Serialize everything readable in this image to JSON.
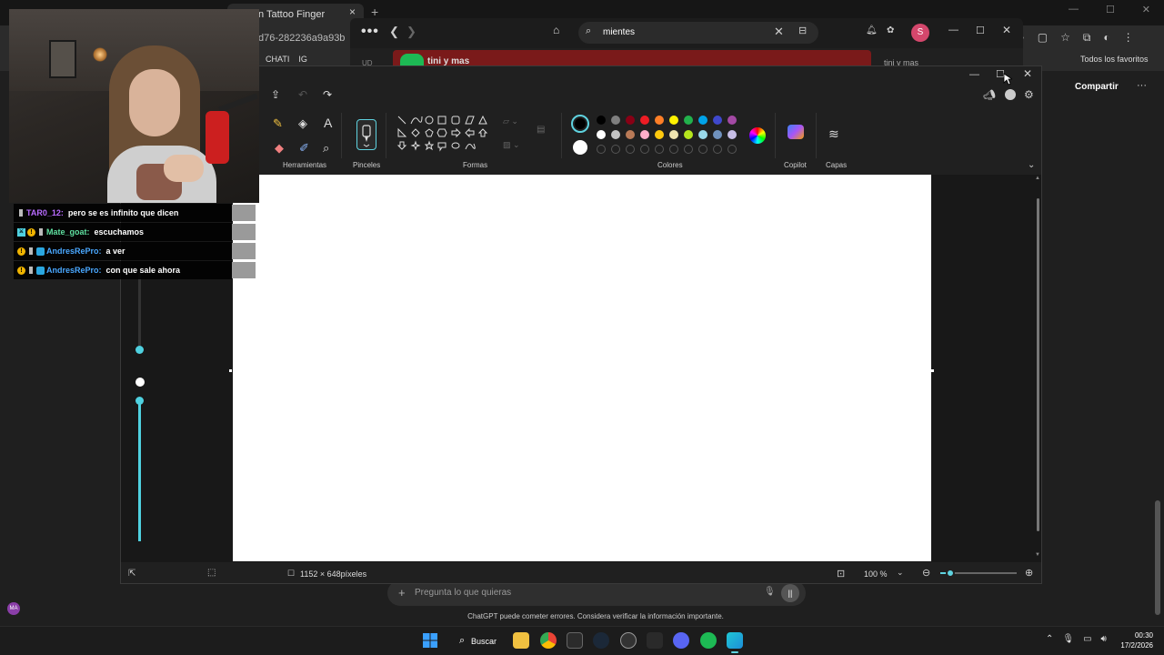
{
  "browser": {
    "tab_title": "n Tattoo Finger",
    "tab_close": "×",
    "new_tab": "+",
    "url_fragment": "d76-282236a9a93b",
    "bookmarks": [
      "CHATI",
      "IG"
    ],
    "favorites_label": "Todos los favoritos",
    "share_label": "Compartir",
    "more": "···",
    "window_controls": [
      "—",
      "☐",
      "✕"
    ]
  },
  "edge": {
    "menu": "•••",
    "search_text": "mientes",
    "profile_initial": "S",
    "banner_text": "tini y mas",
    "banner_text_right": "tini y mas",
    "tab_label": "UD"
  },
  "paint": {
    "groups": {
      "tools": "Herramientas",
      "brushes": "Pinceles",
      "shapes": "Formas",
      "colors": "Colores",
      "copilot": "Copilot",
      "layers": "Capas"
    },
    "primary_color": "#000000",
    "secondary_color": "#ffffff",
    "palette_row1": [
      "#000000",
      "#7f7f7f",
      "#880015",
      "#ed1c24",
      "#ff7f27",
      "#fff200",
      "#22b14c",
      "#00a2e8",
      "#3f48cc",
      "#a349a4"
    ],
    "palette_row2": [
      "#ffffff",
      "#c3c3c3",
      "#b97a57",
      "#ffaec9",
      "#ffc90e",
      "#efe4b0",
      "#b5e61d",
      "#99d9ea",
      "#7092be",
      "#c8bfe7"
    ],
    "canvas_size": "1152 × 648píxeles",
    "zoom": "100 %",
    "zoom_level_fraction": 0.1
  },
  "chatgpt": {
    "placeholder": "Pregunta lo que quieras",
    "disclaimer": "ChatGPT puede cometer errores. Considera verificar la información importante.",
    "avatar_initials": "MA"
  },
  "chat": [
    {
      "user": "TAR0_12:",
      "user_color": "#b86bff",
      "message": "pero se es infinito que dicen",
      "badges": [
        "sub"
      ]
    },
    {
      "user": "Mate_goat:",
      "user_color": "#5fe0a0",
      "message": "escuchamos",
      "badges": [
        "mod",
        "bits",
        "sub"
      ]
    },
    {
      "user": "AndresRePro:",
      "user_color": "#4aa8ff",
      "message": "a ver",
      "badges": [
        "bits",
        "sub",
        "cube"
      ]
    },
    {
      "user": "AndresRePro:",
      "user_color": "#4aa8ff",
      "message": "con que sale ahora",
      "badges": [
        "bits",
        "sub",
        "cube"
      ]
    }
  ],
  "taskbar": {
    "search_label": "Buscar",
    "time": "00:30",
    "date": "17/2/2026"
  }
}
